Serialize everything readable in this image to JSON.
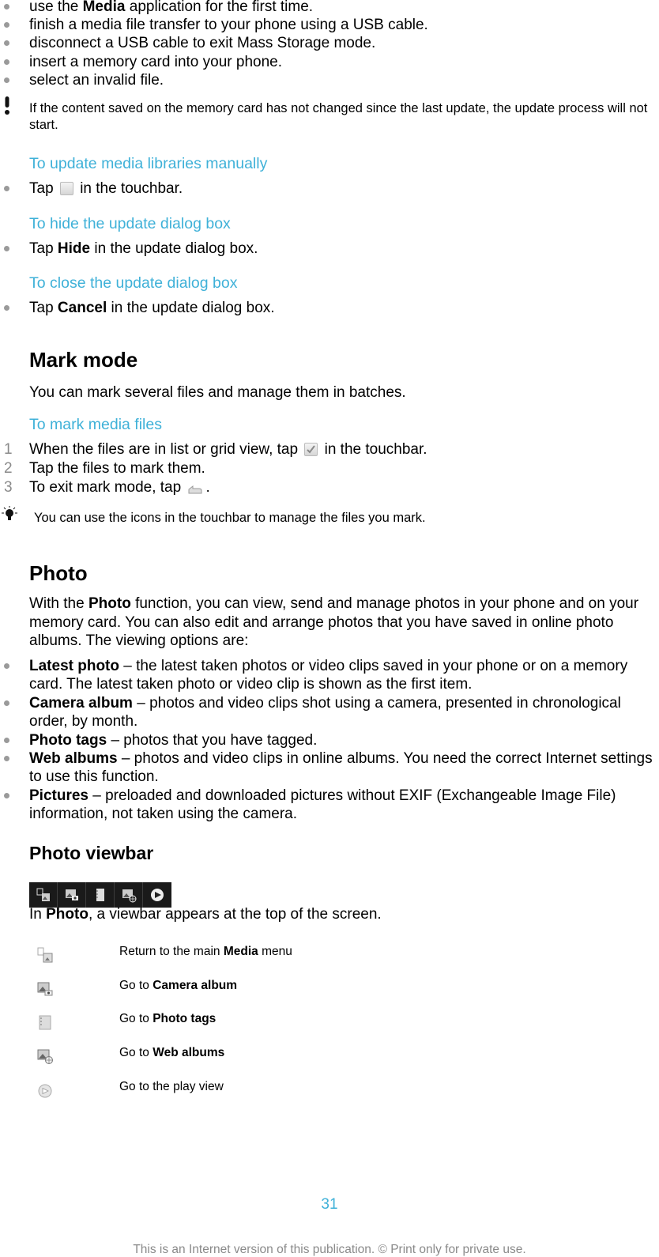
{
  "top_bullets": [
    {
      "pre": "use the ",
      "bold": "Media",
      "post": " application for the first time."
    },
    {
      "pre": "finish a media file transfer to your phone using a USB cable.",
      "bold": "",
      "post": ""
    },
    {
      "pre": "disconnect a USB cable to exit Mass Storage mode.",
      "bold": "",
      "post": ""
    },
    {
      "pre": "insert a memory card into your phone.",
      "bold": "",
      "post": ""
    },
    {
      "pre": "select an invalid file.",
      "bold": "",
      "post": ""
    }
  ],
  "warning_note": "If the content saved on the memory card has not changed since the last update, the update process will not start.",
  "update_manually": {
    "heading": "To update media libraries manually",
    "pre": "Tap ",
    "icon": "update-library-icon",
    "post": " in the touchbar."
  },
  "hide_dialog": {
    "heading": "To hide the update dialog box",
    "pre": "Tap ",
    "bold": "Hide",
    "post": " in the update dialog box."
  },
  "close_dialog": {
    "heading": "To close the update dialog box",
    "pre": "Tap ",
    "bold": "Cancel",
    "post": " in the update dialog box."
  },
  "mark_mode": {
    "title": "Mark mode",
    "intro": "You can mark several files and manage them in batches.",
    "task_heading": "To mark media files",
    "steps": [
      {
        "num": "1",
        "pre": "When the files are in list or grid view, tap ",
        "icon": "mark-checkbox-icon",
        "post": " in the touchbar."
      },
      {
        "num": "2",
        "pre": "Tap the files to mark them.",
        "icon": "",
        "post": ""
      },
      {
        "num": "3",
        "pre": "To exit mark mode, tap ",
        "icon": "back-icon",
        "post": "."
      }
    ],
    "tip": "You can use the icons in the touchbar to manage the files you mark."
  },
  "photo": {
    "title": "Photo",
    "intro_pre": "With the ",
    "intro_bold": "Photo",
    "intro_post": " function, you can view, send and manage photos in your phone and on your memory card. You can also edit and arrange photos that you have saved in online photo albums. The viewing options are:",
    "options": [
      {
        "bold": "Latest photo",
        "text": " – the latest taken photos or video clips saved in your phone or on a memory card. The latest taken photo or video clip is shown as the first item."
      },
      {
        "bold": "Camera album",
        "text": " – photos and video clips shot using a camera, presented in chronological order, by month."
      },
      {
        "bold": "Photo tags",
        "text": " – photos that you have tagged."
      },
      {
        "bold": "Web albums",
        "text": " – photos and video clips in online albums. You need the correct Internet settings to use this function."
      },
      {
        "bold": "Pictures",
        "text": " – preloaded and downloaded pictures without EXIF (Exchangeable Image File) information, not taken using the camera."
      }
    ]
  },
  "viewbar": {
    "title": "Photo viewbar",
    "buttons": [
      "media-menu-icon",
      "camera-album-icon",
      "photo-tags-icon",
      "web-albums-icon",
      "play-icon"
    ],
    "desc_pre": "In ",
    "desc_bold": "Photo",
    "desc_post": ", a viewbar appears at the top of the screen.",
    "rows": [
      {
        "icon": "media-menu-icon",
        "pre": "Return to the main ",
        "bold": "Media",
        "post": " menu"
      },
      {
        "icon": "camera-album-icon",
        "pre": "Go to ",
        "bold": "Camera album",
        "post": ""
      },
      {
        "icon": "photo-tags-icon",
        "pre": "Go to ",
        "bold": "Photo tags",
        "post": ""
      },
      {
        "icon": "web-albums-icon",
        "pre": "Go to ",
        "bold": "Web albums",
        "post": ""
      },
      {
        "icon": "play-icon",
        "pre": "Go to the play view",
        "bold": "",
        "post": ""
      }
    ]
  },
  "page_number": "31",
  "footer": "This is an Internet version of this publication. © Print only for private use.",
  "colors": {
    "accent": "#3fb1d8",
    "bullet": "#9a9a9a",
    "footer": "#8a8a8a"
  }
}
